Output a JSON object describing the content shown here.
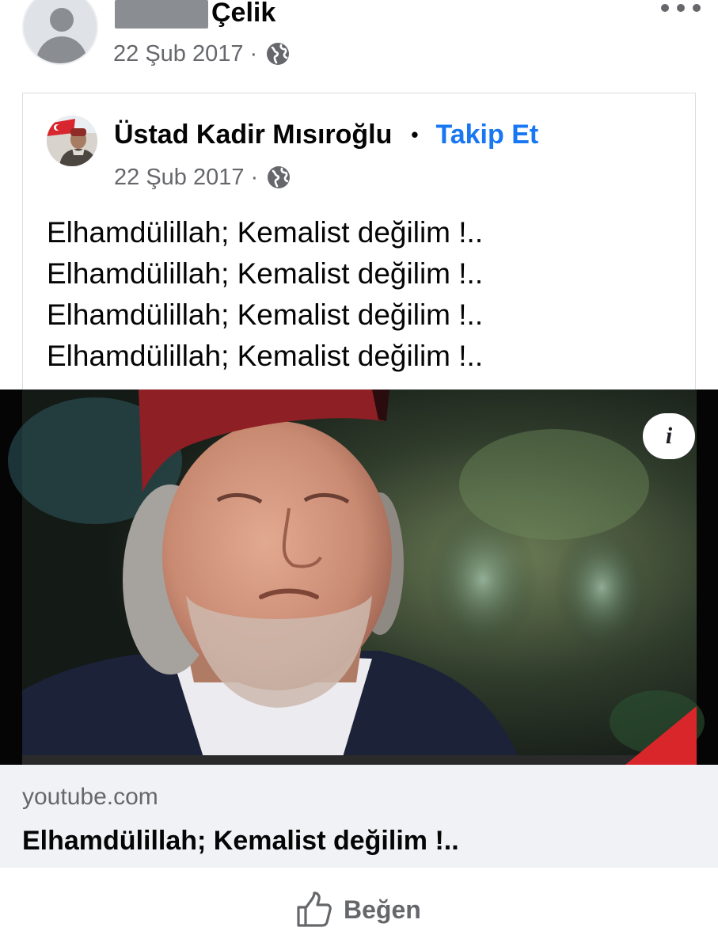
{
  "post": {
    "author_name": "Çelik",
    "date": "22 Şub 2017",
    "separator": "·"
  },
  "shared": {
    "author_name": "Üstad Kadir Mısıroğlu",
    "bullet": "•",
    "follow_label": "Takip Et",
    "date": "22 Şub 2017",
    "separator": "·",
    "text_lines": [
      "Elhamdülillah; Kemalist değilim !..",
      "Elhamdülillah; Kemalist değilim !..",
      "Elhamdülillah; Kemalist değilim !..",
      "Elhamdülillah; Kemalist değilim !.."
    ]
  },
  "preview": {
    "info_icon": "i"
  },
  "link": {
    "domain": "youtube.com",
    "title": "Elhamdülillah; Kemalist değilim !.."
  },
  "actions": {
    "like_label": "Beğen"
  },
  "icons": {
    "globe": "globe-icon",
    "like": "thumbs-up-icon",
    "more": "more-icon",
    "info": "info-icon"
  },
  "colors": {
    "link_blue": "#1877f2",
    "meta_gray": "#65676b",
    "caption_bg": "#f0f2f5"
  }
}
